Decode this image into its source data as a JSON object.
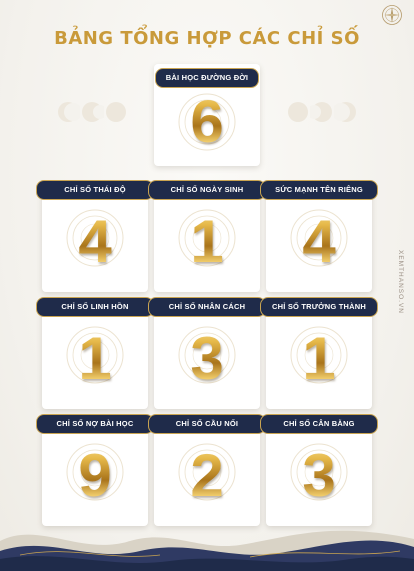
{
  "title": "BẢNG TỔNG HỢP CÁC CHỈ SỐ",
  "watermark": "XEMTHANSO.VN",
  "colors": {
    "gold": "#c99a3a",
    "navy": "#1f2b4a",
    "background": "#f4f2ed"
  },
  "cards": [
    {
      "label": "BÀI HỌC ĐƯỜNG ĐỜI",
      "value": "6"
    },
    {
      "label": "CHỈ SỐ THÁI ĐỘ",
      "value": "4"
    },
    {
      "label": "CHỈ SỐ NGÀY SINH",
      "value": "1"
    },
    {
      "label": "SỨC MẠNH TÊN RIÊNG",
      "value": "4"
    },
    {
      "label": "CHỈ SỐ LINH HỒN",
      "value": "1"
    },
    {
      "label": "CHỈ SỐ NHÂN CÁCH",
      "value": "3"
    },
    {
      "label": "CHỈ SỐ TRƯỞNG THÀNH",
      "value": "1"
    },
    {
      "label": "CHỈ SỐ NỢ BÀI HỌC",
      "value": "9"
    },
    {
      "label": "CHỈ SỐ CẦU NỐI",
      "value": "2"
    },
    {
      "label": "CHỈ SỐ CÂN BẰNG",
      "value": "3"
    }
  ],
  "icons": {
    "logo": "compass-logo-icon",
    "moon": "moon-phase-icon",
    "wheel": "zodiac-wheel-icon"
  }
}
